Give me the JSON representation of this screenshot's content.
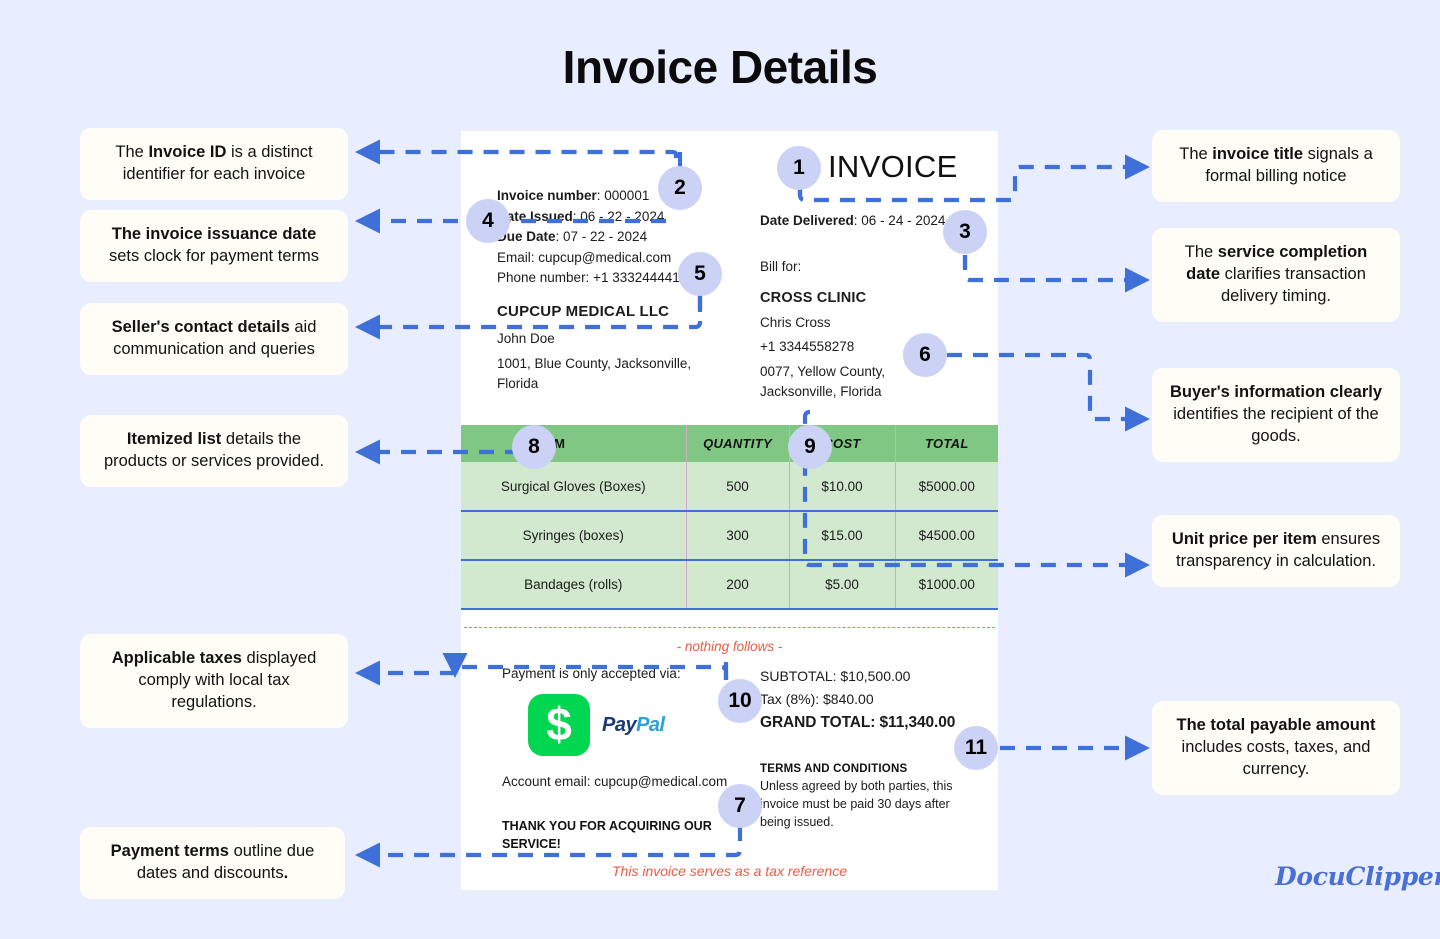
{
  "page": {
    "title": "Invoice Details",
    "background_color": "#e8eeff",
    "logo": "DocuClipper"
  },
  "invoice": {
    "heading": "INVOICE",
    "seller": {
      "invoice_number_label": "Invoice number",
      "invoice_number_value": ": 000001",
      "date_issued_label": "Date Issued",
      "date_issued_value": ": 06 - 22 - 2024",
      "due_date_label": "Due Date",
      "due_date_value": ": 07 - 22 - 2024",
      "email": "Email: cupcup@medical.com",
      "phone": "Phone number: +1 333244441",
      "company": "CUPCUP MEDICAL LLC",
      "contact_person": "John Doe",
      "address": "1001, Blue County, Jacksonville, Florida"
    },
    "delivery": {
      "date_delivered_label": "Date Delivered",
      "date_delivered_value": ": 06 - 24 - 2024"
    },
    "buyer": {
      "bill_for_label": "Bill for:",
      "company": "CROSS CLINIC",
      "contact_person": "Chris Cross",
      "phone": "+1 3344558278",
      "address": "0077, Yellow County, Jacksonville, Florida"
    },
    "table": {
      "columns": [
        "ITEM",
        "QUANTITY",
        "COST",
        "TOTAL"
      ],
      "rows": [
        {
          "item": "Surgical Gloves (Boxes)",
          "quantity": "500",
          "cost": "$10.00",
          "total": "$5000.00"
        },
        {
          "item": "Syringes (boxes)",
          "quantity": "300",
          "cost": "$15.00",
          "total": "$4500.00"
        },
        {
          "item": "Bandages (rolls)",
          "quantity": "200",
          "cost": "$5.00",
          "total": "$1000.00"
        }
      ]
    },
    "nothing_follows": "- nothing follows -",
    "payment": {
      "heading": "Payment is only accepted via:",
      "method_pay": "Pay",
      "method_pal": "Pal",
      "method_symbol": "$",
      "account_email": "Account email: cupcup@medical.com",
      "thank_you": "THANK YOU FOR ACQUIRING OUR SERVICE!"
    },
    "totals": {
      "subtotal": "SUBTOTAL: $10,500.00",
      "tax": "Tax (8%): $840.00",
      "grand_total": "GRAND TOTAL: $11,340.00"
    },
    "terms": {
      "heading": "TERMS AND CONDITIONS",
      "body": "Unless agreed by both parties, this invoice must be paid 30 days after being issued."
    },
    "tax_reference": "This invoice serves as a tax reference"
  },
  "badges": [
    {
      "number": "1"
    },
    {
      "number": "2"
    },
    {
      "number": "3"
    },
    {
      "number": "4"
    },
    {
      "number": "5"
    },
    {
      "number": "6"
    },
    {
      "number": "7"
    },
    {
      "number": "8"
    },
    {
      "number": "9"
    },
    {
      "number": "10"
    },
    {
      "number": "11"
    }
  ],
  "callouts": {
    "invoice_id": {
      "pre": "The ",
      "bold": "Invoice ID",
      "post": " is a distinct identifier for each invoice"
    },
    "issuance_date": {
      "pre": "",
      "bold": "The invoice issuance date",
      "post": " sets clock for payment terms"
    },
    "seller_contact": {
      "pre": "",
      "bold": "Seller's contact details",
      "post": " aid communication and queries"
    },
    "itemized_list": {
      "pre": "",
      "bold": "Itemized list",
      "post": " details the products or services provided."
    },
    "applicable_taxes": {
      "pre": "",
      "bold": "Applicable taxes",
      "post": " displayed comply with local tax regulations."
    },
    "payment_terms": {
      "pre": "",
      "bold": "Payment terms",
      "post": " outline due dates and discounts",
      "tail_bold": "."
    },
    "invoice_title": {
      "pre": "The ",
      "bold": "invoice title",
      "post": " signals a formal billing notice"
    },
    "service_date": {
      "pre": "The ",
      "bold": "service completion date",
      "post": " clarifies transaction delivery timing."
    },
    "buyer_info": {
      "pre": "",
      "bold": "Buyer's information clearly",
      "post": " identifies the recipient of the goods."
    },
    "unit_price": {
      "pre": "",
      "bold": "Unit price per item",
      "post": " ensures transparency in calculation."
    },
    "total_amount": {
      "pre": "",
      "bold": "The total payable amount",
      "post": " includes costs, taxes, and currency."
    }
  },
  "colors": {
    "accent_blue": "#3f6fd8",
    "badge_fill": "#ccd2f5",
    "table_header_green": "#81c784",
    "table_body_green": "#d2e9cf",
    "divider_red": "#ef5b44",
    "paypal_green": "#00d64f"
  }
}
